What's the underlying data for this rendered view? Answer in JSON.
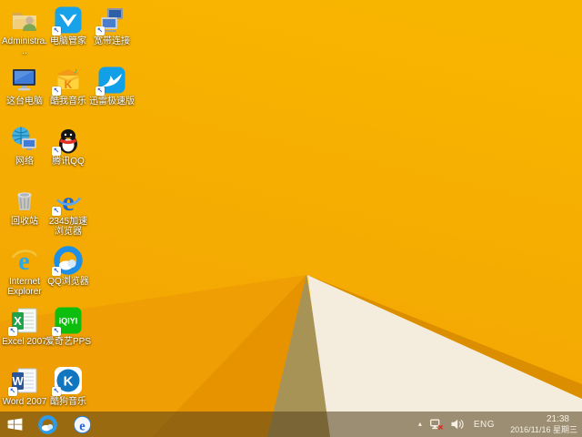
{
  "wallpaper": {
    "colors": {
      "base_top": "#F8B500",
      "base_bottom": "#F2A403",
      "fan_mid": "#EF9E03",
      "fan_dark": "#E79300",
      "olive": "#A89357",
      "white_fold": "#F4EDDE",
      "fold_edge": "#DB8E00"
    }
  },
  "desktop": {
    "shortcut_arrow_glyph": "↖",
    "icons": [
      {
        "label": "Administra...",
        "icon": "admin",
        "shortcut": false,
        "col": 0,
        "row": 0
      },
      {
        "label": "电脑管家",
        "icon": "guanjia",
        "shortcut": true,
        "col": 1,
        "row": 0
      },
      {
        "label": "宽带连接",
        "icon": "broadband",
        "shortcut": true,
        "col": 2,
        "row": 0
      },
      {
        "label": "这台电脑",
        "icon": "pc",
        "shortcut": false,
        "col": 0,
        "row": 1
      },
      {
        "label": "酷我音乐",
        "icon": "kuwo",
        "shortcut": true,
        "col": 1,
        "row": 1
      },
      {
        "label": "迅雷极速版",
        "icon": "xunlei",
        "shortcut": true,
        "col": 2,
        "row": 1
      },
      {
        "label": "网络",
        "icon": "network",
        "shortcut": false,
        "col": 0,
        "row": 2
      },
      {
        "label": "腾讯QQ",
        "icon": "qq",
        "shortcut": true,
        "col": 1,
        "row": 2
      },
      {
        "label": "回收站",
        "icon": "recycle",
        "shortcut": false,
        "col": 0,
        "row": 3
      },
      {
        "label": "2345加速浏览器",
        "icon": "e2345",
        "shortcut": true,
        "col": 1,
        "row": 3
      },
      {
        "label": "Internet Explorer",
        "icon": "ie",
        "shortcut": false,
        "col": 0,
        "row": 4
      },
      {
        "label": "QQ浏览器",
        "icon": "qqbrowser",
        "shortcut": true,
        "col": 1,
        "row": 4
      },
      {
        "label": "Excel 2007",
        "icon": "excel",
        "shortcut": true,
        "col": 0,
        "row": 5
      },
      {
        "label": "爱奇艺PPS",
        "icon": "iqiyi",
        "shortcut": true,
        "col": 1,
        "row": 5
      },
      {
        "label": "Word 2007",
        "icon": "word",
        "shortcut": true,
        "col": 0,
        "row": 6
      },
      {
        "label": "酷狗音乐",
        "icon": "kugou",
        "shortcut": true,
        "col": 1,
        "row": 6
      }
    ]
  },
  "taskbar": {
    "pinned": [
      {
        "name": "qq-browser",
        "icon": "qqbrowser_tb"
      },
      {
        "name": "2345-browser",
        "icon": "e2345_tb"
      }
    ],
    "tray": {
      "overflow_glyph": "▴",
      "language": "ENG",
      "time": "21:38",
      "date": "2016/11/16 星期三"
    }
  }
}
